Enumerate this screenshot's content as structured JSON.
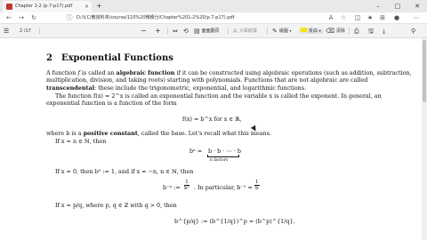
{
  "window": {
    "tab_title": "Chapter 1-2 (p.7-p17).pdf",
    "tab_close": "×",
    "new_tab": "+",
    "minimize": "–",
    "maximize": "□",
    "close": "✕"
  },
  "address_bar": {
    "url": "D:/V.C/教資料夾/course/110%20微積分/Chapter%201-2%20(p.7-p17).pdf"
  },
  "pdf_toolbar": {
    "page_current": "2",
    "page_total": "/17",
    "zoom_out": "−",
    "zoom_in": "+",
    "fit_page_label": "面面翻頁",
    "read_aloud_label": "大聲朗讀",
    "draw_label": "繪圖",
    "highlight_label": "反白",
    "erase_label": "清除",
    "highlight_color": "#f5e600"
  },
  "document": {
    "section_number": "2",
    "section_title": "Exponential Functions",
    "p1_a": "A function ",
    "p1_f": "f",
    "p1_b": " is called an ",
    "p1_term": "algebraic function",
    "p1_c": " if it can be constructed using algebraic operations (such as addition, subtraction, multiplication, division, and taking roots) starting with polynomials. Functions that are not algebraic are called ",
    "p1_term2": "transcendental",
    "p1_d": ": these include the trigonometric, exponential, and logarithmic functions.",
    "p2": "The function f(x) = 2^x is called an exponential function and the variable x is called the exponent. In general, an exponential function is a function of the form",
    "eq1": "f(x) = b^x for x ∈ ℝ,",
    "p3_a": "where b is a ",
    "p3_term": "positive constant",
    "p3_b": ", called the base. Let's recall what this means.",
    "case1": "If x = n ∈ ℕ, then",
    "eq2_lhs": "bⁿ =",
    "eq2_rhs": "b · b · ⋯ · b",
    "eq2_under": "n factors",
    "case2": "If x = 0, then b⁰ := 1, and if x = −n, n ∈ ℕ, then",
    "eq3_lhs": "b⁻ⁿ :=",
    "eq3_num": "1",
    "eq3_den": "bⁿ",
    "eq3_mid": ". In particular, b⁻¹ =",
    "eq3_num2": "1",
    "eq3_den2": "b",
    "case3": "If x = p/q, where p, q ∈ ℤ with q > 0, then",
    "eq4": "b^{p/q} := (b^{1/q})^p = (b^p)^{1/q}."
  }
}
